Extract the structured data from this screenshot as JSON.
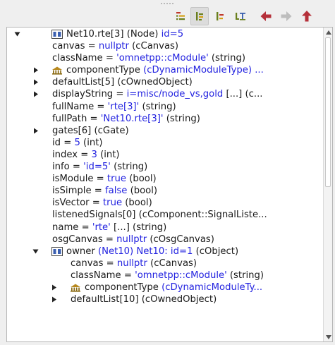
{
  "toolbar": {
    "buttons": [
      {
        "icon": "tree-view-icon",
        "active": false
      },
      {
        "icon": "flat-list-icon",
        "active": true
      },
      {
        "icon": "grouped-view-icon",
        "active": false
      },
      {
        "icon": "text-view-icon",
        "active": false
      },
      {
        "icon": "back-arrow-icon",
        "enabled": true
      },
      {
        "icon": "forward-arrow-icon",
        "enabled": false
      },
      {
        "icon": "up-arrow-icon",
        "enabled": true
      }
    ]
  },
  "colors": {
    "value": "#2323e0",
    "arrow": "#b5303a",
    "arrow_disabled": "#bdbdbd",
    "icon": "#6a7f1d"
  },
  "tree": {
    "rows": [
      {
        "indent": 0,
        "twisty": "expanded",
        "icon": "module-icon",
        "segs": [
          [
            "Net10.rte[3] (Node) ",
            ""
          ],
          [
            "id=5",
            "v"
          ]
        ]
      },
      {
        "indent": 1,
        "segs": [
          [
            "canvas = ",
            ""
          ],
          [
            "nullptr",
            "v"
          ],
          [
            " (cCanvas)",
            ""
          ]
        ]
      },
      {
        "indent": 1,
        "segs": [
          [
            "className = ",
            ""
          ],
          [
            "'omnetpp::cModule'",
            "v"
          ],
          [
            " (string)",
            ""
          ]
        ]
      },
      {
        "indent": 1,
        "twisty": "collapsed",
        "icon": "module-type-icon",
        "segs": [
          [
            "componentType ",
            ""
          ],
          [
            "(cDynamicModuleType) ...",
            "v"
          ]
        ]
      },
      {
        "indent": 1,
        "twisty": "collapsed",
        "segs": [
          [
            "defaultList[5] (cOwnedObject)",
            ""
          ]
        ]
      },
      {
        "indent": 1,
        "twisty": "collapsed",
        "segs": [
          [
            "displayString = ",
            ""
          ],
          [
            "i=misc/node_vs,gold",
            "v"
          ],
          [
            " [...]  (c...",
            ""
          ]
        ]
      },
      {
        "indent": 1,
        "segs": [
          [
            "fullName = ",
            ""
          ],
          [
            "'rte[3]'",
            "v"
          ],
          [
            " (string)",
            ""
          ]
        ]
      },
      {
        "indent": 1,
        "segs": [
          [
            "fullPath = ",
            ""
          ],
          [
            "'Net10.rte[3]'",
            "v"
          ],
          [
            " (string)",
            ""
          ]
        ]
      },
      {
        "indent": 1,
        "twisty": "collapsed",
        "segs": [
          [
            "gates[6] (cGate)",
            ""
          ]
        ]
      },
      {
        "indent": 1,
        "segs": [
          [
            "id = ",
            ""
          ],
          [
            "5",
            "v"
          ],
          [
            " (int)",
            ""
          ]
        ]
      },
      {
        "indent": 1,
        "segs": [
          [
            "index = ",
            ""
          ],
          [
            "3",
            "v"
          ],
          [
            " (int)",
            ""
          ]
        ]
      },
      {
        "indent": 1,
        "segs": [
          [
            "info = ",
            ""
          ],
          [
            "'id=5'",
            "v"
          ],
          [
            " (string)",
            ""
          ]
        ]
      },
      {
        "indent": 1,
        "segs": [
          [
            "isModule = ",
            ""
          ],
          [
            "true",
            "v"
          ],
          [
            " (bool)",
            ""
          ]
        ]
      },
      {
        "indent": 1,
        "segs": [
          [
            "isSimple = ",
            ""
          ],
          [
            "false",
            "v"
          ],
          [
            " (bool)",
            ""
          ]
        ]
      },
      {
        "indent": 1,
        "segs": [
          [
            "isVector = ",
            ""
          ],
          [
            "true",
            "v"
          ],
          [
            " (bool)",
            ""
          ]
        ]
      },
      {
        "indent": 1,
        "segs": [
          [
            "listenedSignals[0] (cComponent::SignalListe...",
            ""
          ]
        ]
      },
      {
        "indent": 1,
        "segs": [
          [
            "name = ",
            ""
          ],
          [
            "'rte'",
            "v"
          ],
          [
            " [...]  (string)",
            ""
          ]
        ]
      },
      {
        "indent": 1,
        "segs": [
          [
            "osgCanvas = ",
            ""
          ],
          [
            "nullptr",
            "v"
          ],
          [
            " (cOsgCanvas)",
            ""
          ]
        ]
      },
      {
        "indent": 1,
        "twisty": "expanded",
        "icon": "module-icon",
        "segs": [
          [
            "owner ",
            ""
          ],
          [
            "(Net10) Net10: id=1",
            "v"
          ],
          [
            " (cObject)",
            ""
          ]
        ]
      },
      {
        "indent": 2,
        "segs": [
          [
            "canvas = ",
            ""
          ],
          [
            "nullptr",
            "v"
          ],
          [
            " (cCanvas)",
            ""
          ]
        ]
      },
      {
        "indent": 2,
        "segs": [
          [
            "className = ",
            ""
          ],
          [
            "'omnetpp::cModule'",
            "v"
          ],
          [
            " (string)",
            ""
          ]
        ]
      },
      {
        "indent": 2,
        "twisty": "collapsed",
        "icon": "module-type-icon",
        "segs": [
          [
            "componentType ",
            ""
          ],
          [
            "(cDynamicModuleTy...",
            "v"
          ]
        ]
      },
      {
        "indent": 2,
        "twisty": "collapsed",
        "segs": [
          [
            "defaultList[10] (cOwnedObject)",
            ""
          ]
        ]
      }
    ]
  }
}
